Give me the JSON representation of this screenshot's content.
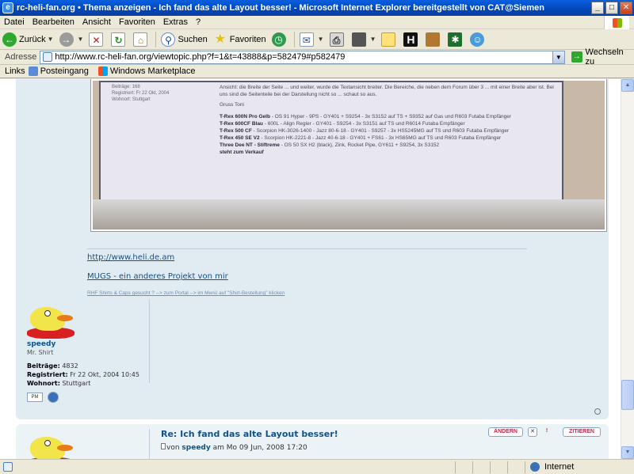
{
  "window": {
    "title": "rc-heli-fan.org • Thema anzeigen - Ich fand das alte Layout besser! - Microsoft Internet Explorer bereitgestellt von CAT@Siemen",
    "minimize": "_",
    "maximize": "□",
    "close": "✕"
  },
  "menu": [
    "Datei",
    "Bearbeiten",
    "Ansicht",
    "Favoriten",
    "Extras",
    "?"
  ],
  "toolbar": {
    "back": "Zurück",
    "search": "Suchen",
    "favorites": "Favoriten"
  },
  "address": {
    "label": "Adresse",
    "url": "http://www.rc-heli-fan.org/viewtopic.php?f=1&t=43888&p=582479#p582479",
    "go": "Wechseln zu"
  },
  "links": {
    "label": "Links",
    "items": [
      "Posteingang",
      "Windows Marketplace"
    ]
  },
  "post1": {
    "photo": {
      "left_lines": [
        "Beiträge: 168",
        "Registriert: Fr 22 Okt, 2004",
        "Wohnort: Stuttgart"
      ],
      "intro": "Ansicht: die Breite der Seite ... und weiter, wurde die Textansicht breiter. Die Bereiche, die neben dem Forum über 3 ... mit einer Breite aber ist. Bei uns sind die Seitenteile bei der Darstellung nicht so ... schaut so aus.",
      "greeting": "Gruss Toni",
      "lines": [
        {
          "bold": "T-Rex 600N Pro Gelb",
          "text": " - OS 91 Hyper - 9PS - GY401 + S9254 - 3x S3152 auf TS + S9352 auf Gas und R603 Futaba Empfänger"
        },
        {
          "bold": "T-Rex 600CF Blau",
          "text": " - 600L - Align Regler - GY401 - S9254 - 3x S3151 auf TS und R6014 Futaba Empfänger"
        },
        {
          "bold": "T-Rex 500 CF",
          "text": " - Scorpion HK-3026-1400 - Jazz 80-6-18 - GY401 - S9257 - 3x HS5245MG auf TS und R603 Futaba Empfänger"
        },
        {
          "bold": "T-Rex 450 SE V2",
          "text": " - Scorpion HK-2221-8 - Jazz 40-6-18 - GY401 + FS61 - 3x HS65MG auf TS und R603 Futaba Empfänger"
        },
        {
          "bold": "Three Dee NT - Stiftreme",
          "text": " - OS 50 SX H2 (black), Zink, Rocket Pipe, GY611 + S9254, 3x S3152"
        },
        {
          "bold": "steht zum Verkauf",
          "text": ""
        }
      ]
    },
    "sig_link1": "http://www.heli.de.am",
    "sig_link2": "MUGS - ein anderes Projekt von mir",
    "sig_small": "RHF Shirts & Caps gesucht ? --> zum Portal --> im Menü auf \"Shirt-Bestellung\" klicken",
    "author": "speedy",
    "rank": "Mr. Shirt",
    "posts_label": "Beiträge:",
    "posts_value": "4832",
    "registered_label": "Registriert:",
    "registered_value": "Fr 22 Okt, 2004 10:45",
    "location_label": "Wohnort:",
    "location_value": "Stuttgart",
    "pm": "PM"
  },
  "post2": {
    "title": "Re: Ich fand das alte Layout besser!",
    "meta_von": "von",
    "author": "speedy",
    "meta_date": "am Mo 09 Jun, 2008 17:20",
    "edit": "ÄNDERN",
    "delete": "✕",
    "report": "!",
    "quote": "ZITIEREN"
  },
  "status": {
    "zone": "Internet"
  }
}
